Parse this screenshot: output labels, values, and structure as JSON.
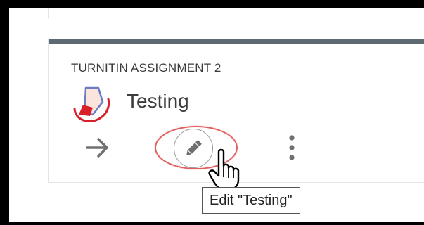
{
  "activity": {
    "type_label": "TURNITIN ASSIGNMENT 2",
    "title": "Testing",
    "logo_icon": "turnitin-logo",
    "accent_bar_color": "#5d6a74"
  },
  "actions": {
    "go_icon": "arrow-right-icon",
    "edit_icon": "pencil-icon",
    "more_icon": "vertical-ellipsis-icon"
  },
  "tooltip": {
    "text": "Edit \"Testing\""
  },
  "highlight_color": "#e06060"
}
